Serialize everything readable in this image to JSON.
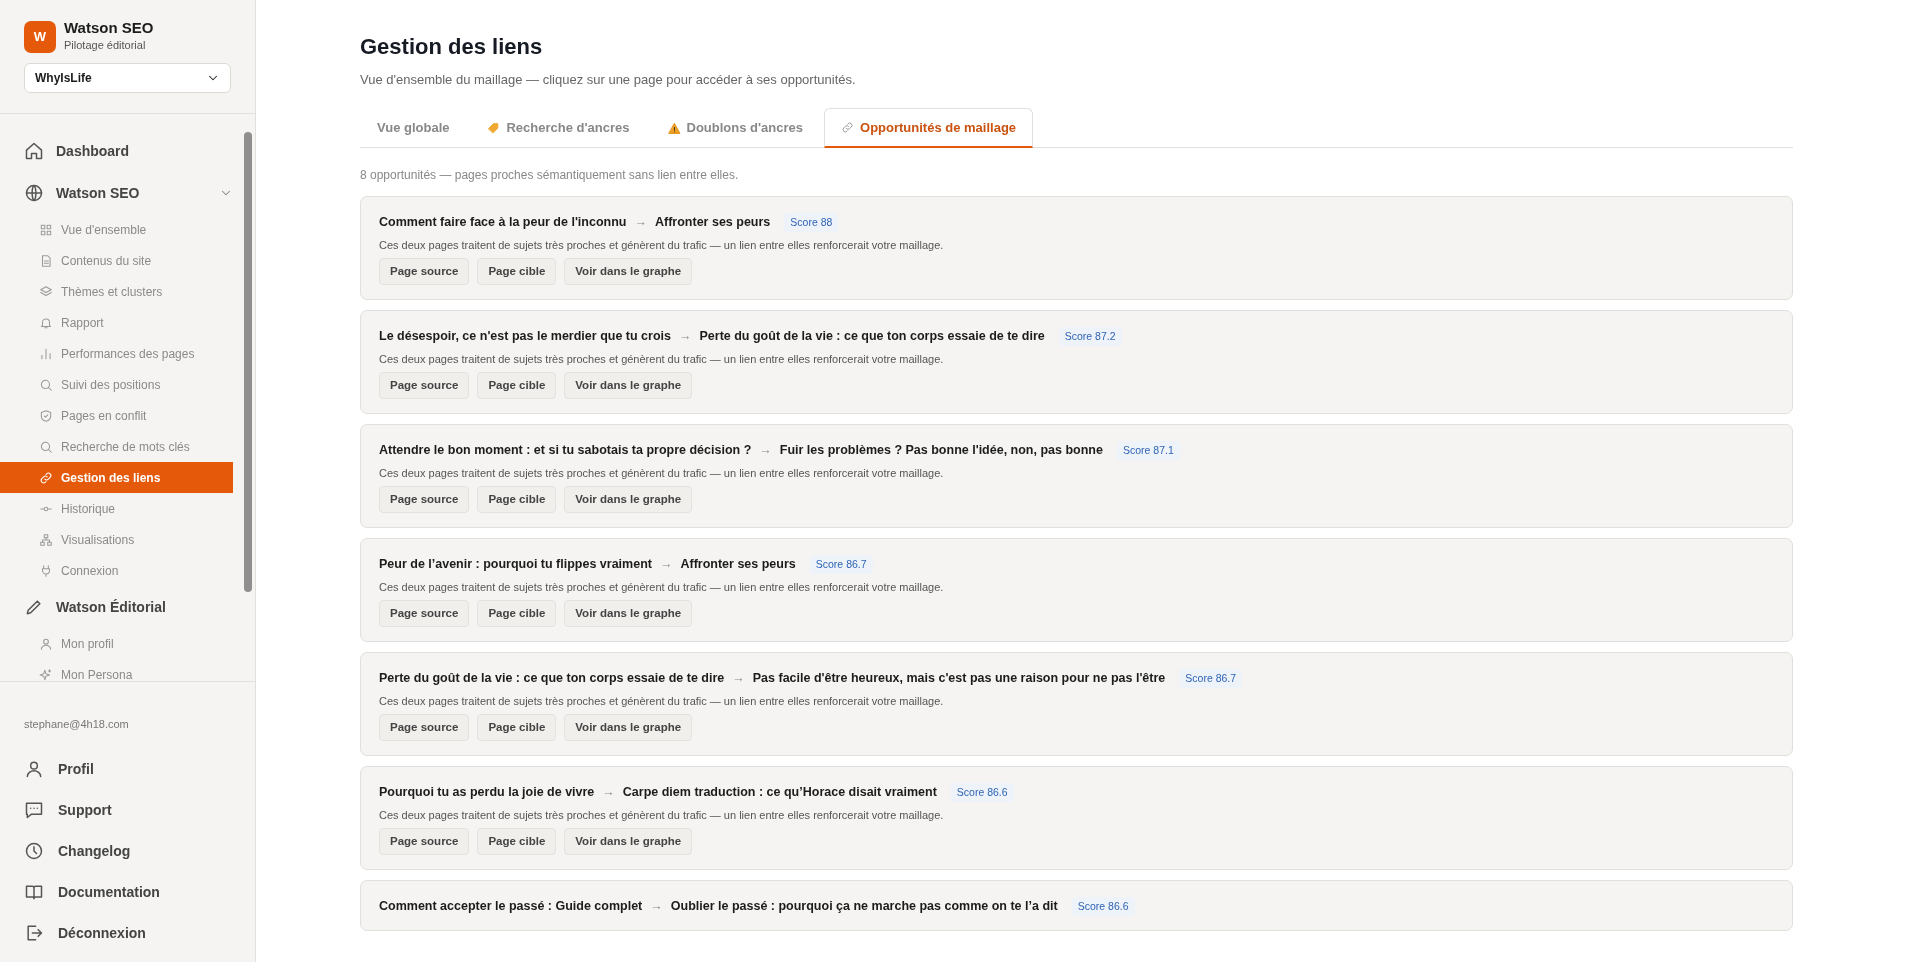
{
  "brand": {
    "logo": "W",
    "name": "Watson SEO",
    "tagline": "Pilotage éditorial"
  },
  "site_select": {
    "value": "WhyIsLife"
  },
  "nav": [
    {
      "label": "Dashboard",
      "collapsible": false
    },
    {
      "label": "Watson SEO",
      "collapsible": true,
      "children": [
        {
          "label": "Vue d'ensemble",
          "selected": false
        },
        {
          "label": "Contenus du site",
          "selected": false
        },
        {
          "label": "Thèmes et clusters",
          "selected": false
        },
        {
          "label": "Rapport",
          "selected": false
        },
        {
          "label": "Performances des pages",
          "selected": false
        },
        {
          "label": "Suivi des positions",
          "selected": false
        },
        {
          "label": "Pages en conflit",
          "selected": false
        },
        {
          "label": "Recherche de mots clés",
          "selected": false
        },
        {
          "label": "Gestion des liens",
          "selected": true
        },
        {
          "label": "Historique",
          "selected": false
        },
        {
          "label": "Visualisations",
          "selected": false
        },
        {
          "label": "Connexion",
          "selected": false
        }
      ]
    },
    {
      "label": "Watson Éditorial",
      "collapsible": false,
      "children": [
        {
          "label": "Mon profil",
          "selected": false
        },
        {
          "label": "Mon Persona",
          "selected": false
        }
      ]
    }
  ],
  "user_email": "stephane@4h18.com",
  "account_links": [
    "Profil",
    "Support",
    "Changelog",
    "Documentation",
    "Déconnexion"
  ],
  "page": {
    "title": "Gestion des liens",
    "subtitle": "Vue d'ensemble du maillage — cliquez sur une page pour accéder à ses opportunités."
  },
  "tabs": [
    {
      "label": "Vue globale",
      "selected": false
    },
    {
      "label": "Recherche d'ancres",
      "selected": false
    },
    {
      "label": "Doublons d'ancres",
      "selected": false
    },
    {
      "label": "Opportunités de maillage",
      "selected": true
    }
  ],
  "summary": "8 opportunités — pages proches sémantiquement sans lien entre elles.",
  "opportunities": [
    {
      "source": "Comment faire face à la peur de l'inconnu",
      "arrow": "→",
      "target": "Affronter ses peurs",
      "score": "Score 88",
      "description": "Ces deux pages traitent de sujets très proches et génèrent du trafic — un lien entre elles renforcerait votre maillage.",
      "buttons": [
        "Page source",
        "Page cible",
        "Voir dans le graphe"
      ]
    },
    {
      "source": "Le désespoir, ce n'est pas le merdier que tu crois",
      "arrow": "→",
      "target": "Perte du goût de la vie : ce que ton corps essaie de te dire",
      "score": "Score 87.2",
      "description": "Ces deux pages traitent de sujets très proches et génèrent du trafic — un lien entre elles renforcerait votre maillage.",
      "buttons": [
        "Page source",
        "Page cible",
        "Voir dans le graphe"
      ]
    },
    {
      "source": "Attendre le bon moment : et si tu sabotais ta propre décision ?",
      "arrow": "→",
      "target": "Fuir les problèmes ? Pas bonne l'idée, non, pas bonne",
      "score": "Score 87.1",
      "description": "Ces deux pages traitent de sujets très proches et génèrent du trafic — un lien entre elles renforcerait votre maillage.",
      "buttons": [
        "Page source",
        "Page cible",
        "Voir dans le graphe"
      ]
    },
    {
      "source": "Peur de l’avenir : pourquoi tu flippes vraiment",
      "arrow": "→",
      "target": "Affronter ses peurs",
      "score": "Score 86.7",
      "description": "Ces deux pages traitent de sujets très proches et génèrent du trafic — un lien entre elles renforcerait votre maillage.",
      "buttons": [
        "Page source",
        "Page cible",
        "Voir dans le graphe"
      ]
    },
    {
      "source": "Perte du goût de la vie : ce que ton corps essaie de te dire",
      "arrow": "→",
      "target": "Pas facile d'être heureux, mais c'est pas une raison pour ne pas l'être",
      "score": "Score 86.7",
      "description": "Ces deux pages traitent de sujets très proches et génèrent du trafic — un lien entre elles renforcerait votre maillage.",
      "buttons": [
        "Page source",
        "Page cible",
        "Voir dans le graphe"
      ]
    },
    {
      "source": "Pourquoi tu as perdu la joie de vivre",
      "arrow": "→",
      "target": "Carpe diem traduction : ce qu’Horace disait vraiment",
      "score": "Score 86.6",
      "description": "Ces deux pages traitent de sujets très proches et génèrent du trafic — un lien entre elles renforcerait votre maillage.",
      "buttons": [
        "Page source",
        "Page cible",
        "Voir dans le graphe"
      ]
    },
    {
      "source": "Comment accepter le passé : Guide complet",
      "arrow": "→",
      "target": "Oublier le passé : pourquoi ça ne marche pas comme on te l’a dit",
      "score": "Score 86.6"
    }
  ]
}
